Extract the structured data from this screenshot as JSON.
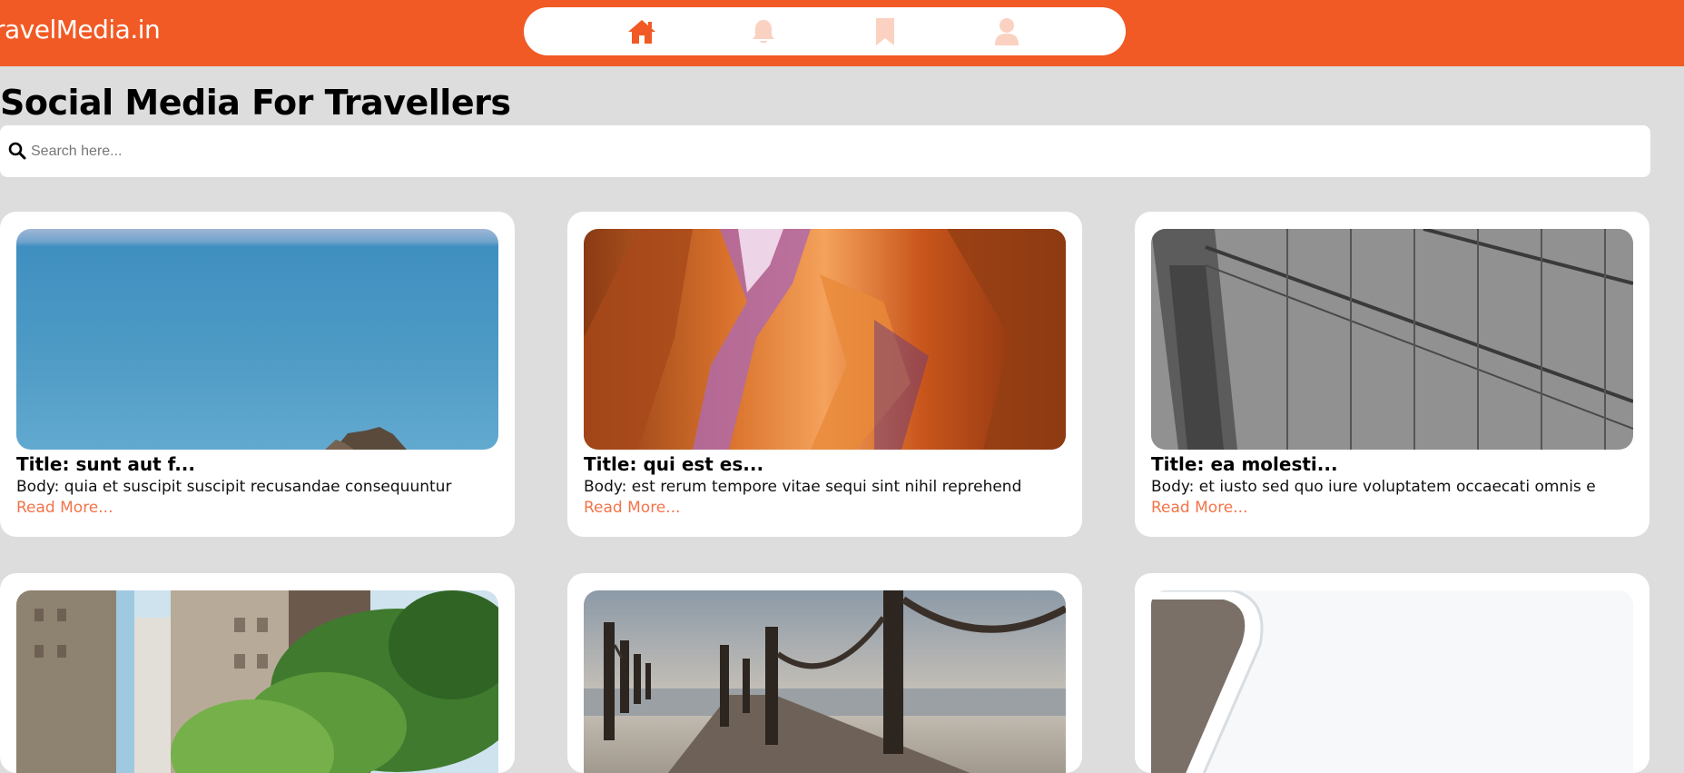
{
  "brand": {
    "name": "ravelMedia.in"
  },
  "nav": {
    "items": [
      {
        "icon": "home-icon",
        "active": true
      },
      {
        "icon": "bell-icon",
        "active": false
      },
      {
        "icon": "bookmark-icon",
        "active": false
      },
      {
        "icon": "user-icon",
        "active": false
      }
    ],
    "accent": "#f15a24",
    "inactive": "#fbd1c2"
  },
  "page": {
    "title": "Social Media For Travellers"
  },
  "search": {
    "placeholder": "Search here...",
    "icon": "search-icon"
  },
  "posts": [
    {
      "title": "Title: sunt aut f...",
      "body": "Body: quia et suscipit suscipit recusandae consequuntur",
      "more": "Read More...",
      "image": "sea-photo"
    },
    {
      "title": "Title: qui est es...",
      "body": "Body: est rerum tempore vitae sequi sint nihil reprehend",
      "more": "Read More...",
      "image": "canyon-photo"
    },
    {
      "title": "Title: ea molesti...",
      "body": "Body: et iusto sed quo iure voluptatem occaecati omnis e",
      "more": "Read More...",
      "image": "bridge-photo"
    },
    {
      "title": "",
      "body": "",
      "more": "",
      "image": "city-street-photo"
    },
    {
      "title": "",
      "body": "",
      "more": "",
      "image": "pier-photo"
    },
    {
      "title": "",
      "body": "",
      "more": "",
      "image": "boat-photo"
    }
  ],
  "colors": {
    "header": "#f15a24",
    "background": "#dddddd",
    "card": "#ffffff",
    "link": "#f2744a"
  }
}
